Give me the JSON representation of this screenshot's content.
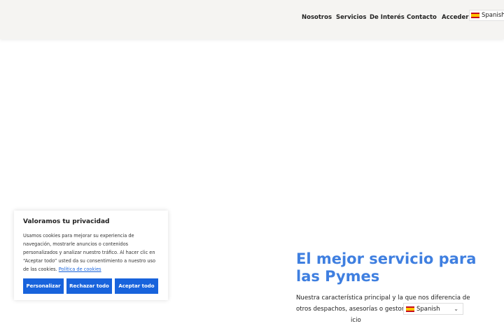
{
  "nav": {
    "items": [
      "Nosotros",
      "Servicios",
      "De Interés",
      "Contacto",
      "Acceder"
    ]
  },
  "language": {
    "selected": "Spanish",
    "flag_colors": {
      "red": "#c60b1e",
      "yellow": "#ffc400"
    }
  },
  "cookie_banner": {
    "title": "Valoramos tu privacidad",
    "body": "Usamos cookies para mejorar su experiencia de navegación, mostrarle anuncios o contenidos personalizados y analizar nuestro tráfico. Al hacer clic en “Aceptar todo” usted da su consentimiento a nuestro uso de las cookies.",
    "link": "Política de cookies",
    "buttons": {
      "customize": "Personalizar",
      "reject": "Rechazar todo",
      "accept": "Aceptar todo"
    },
    "button_color": "#1863dc"
  },
  "hero": {
    "title": "El mejor servicio para las Pymes",
    "text_before": "Nuestra característica principal y la que nos diferencia de otros despachos, asesorías o gestorías, es la",
    "text_after": "icio",
    "title_color": "#3f7fe0"
  },
  "footer_language": {
    "selected": "Spanish",
    "chevron_icon": "chevron-down-icon"
  }
}
